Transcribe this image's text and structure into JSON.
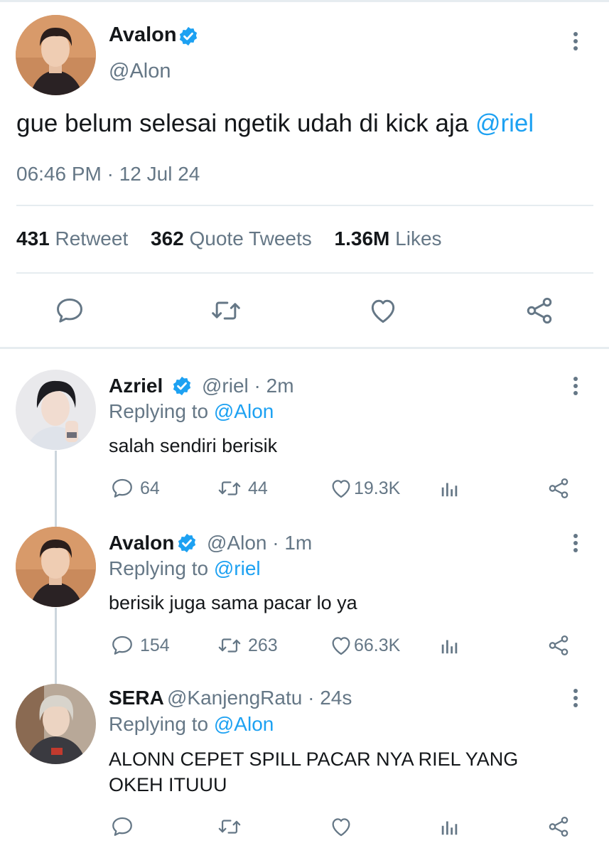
{
  "main_tweet": {
    "name": "Avalon",
    "handle": "@Alon",
    "text_before": "gue belum selesai ngetik udah  di kick aja ",
    "text_mention": "@riel",
    "timestamp": "06:46 PM · 12 Jul 24",
    "stats": {
      "retweets": "431",
      "retweets_label": "Retweet",
      "quotes": "362",
      "quotes_label": "Quote Tweets",
      "likes": "1.36M",
      "likes_label": "Likes"
    }
  },
  "replies": [
    {
      "name": "Azriel",
      "verified": true,
      "handle_time": "@riel · 2m",
      "replying_label": "Replying to ",
      "replying_to": "@Alon",
      "text": "salah sendiri berisik",
      "replies": "64",
      "retweets": "44",
      "likes": "19.3K"
    },
    {
      "name": "Avalon",
      "verified": true,
      "handle_time": "@Alon · 1m",
      "replying_label": "Replying to ",
      "replying_to": "@riel",
      "text": "berisik juga sama pacar lo ya",
      "replies": "154",
      "retweets": "263",
      "likes": "66.3K"
    },
    {
      "name": "SERA",
      "verified": false,
      "handle_time": "@KanjengRatu · 24s",
      "replying_label": "Replying to ",
      "replying_to": "@Alon",
      "text_line1": "ALONN CEPET SPILL PACAR NYA RIEL YANG",
      "text_line2": "OKEH ITUUU",
      "replies": "",
      "retweets": "",
      "likes": ""
    }
  ],
  "colors": {
    "accent": "#1da1f2",
    "muted": "#657786",
    "text": "#14171a",
    "divider": "#e6ecf0"
  },
  "icons": [
    "verified-badge-icon",
    "more-icon",
    "reply-icon",
    "retweet-icon",
    "like-icon",
    "share-icon",
    "analytics-icon"
  ]
}
